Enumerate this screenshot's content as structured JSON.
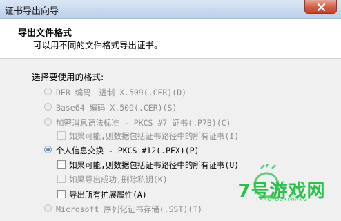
{
  "window": {
    "title": "证书导出向导",
    "close_icon": "close-icon"
  },
  "header": {
    "title": "导出文件格式",
    "subtitle": "可以用不同的文件格式导出证书。"
  },
  "format": {
    "prompt": "选择要使用的格式:",
    "options": [
      {
        "label": "DER 编码二进制 X.509(.CER)(D)",
        "selected": false,
        "enabled": false
      },
      {
        "label": "Base64 编码 X.509(.CER)(S)",
        "selected": false,
        "enabled": false
      },
      {
        "label": "加密消息语法标准 - PKCS #7 证书(.P7B)(C)",
        "selected": false,
        "enabled": false
      },
      {
        "label": "个人信息交换 - PKCS #12(.PFX)(P)",
        "selected": true,
        "enabled": true
      },
      {
        "label": "Microsoft 序列化证书存储(.SST)(T)",
        "selected": false,
        "enabled": false
      }
    ],
    "pkcs7_include_chain": {
      "label": "如果可能,则数据包括证书路径中的所有证书(I)",
      "checked": false,
      "enabled": false
    },
    "pfx_include_chain": {
      "label": "如果可能,则数据包括证书路径中的所有证书(U)",
      "checked": false,
      "enabled": true
    },
    "pfx_delete_key": {
      "label": "如果导出成功,删除私钥(K)",
      "checked": false,
      "enabled": false
    },
    "pfx_export_ext": {
      "label": "导出所有扩展属性(A)",
      "checked": false,
      "enabled": true
    }
  },
  "watermark": {
    "text": "7号游戏网",
    "subtext": "THAOYOUXIWANG",
    "color": "#29c24a"
  }
}
